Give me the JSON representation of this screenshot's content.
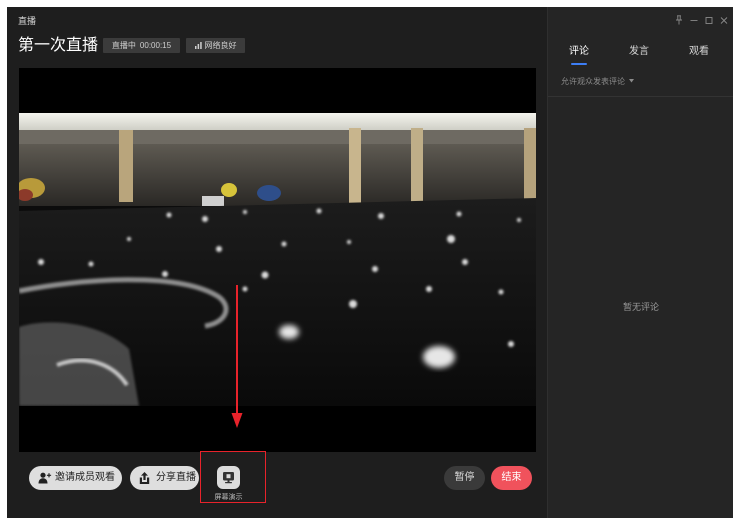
{
  "window": {
    "app_title": "直播"
  },
  "header": {
    "title": "第一次直播",
    "live_status": "直播中",
    "elapsed_time": "00:00:15",
    "network_status": "网络良好"
  },
  "side_panel": {
    "tabs": [
      {
        "label": "评论",
        "active": true
      },
      {
        "label": "发言",
        "active": false
      },
      {
        "label": "观看",
        "active": false
      }
    ],
    "comment_permission": "允许观众发表评论",
    "empty_message": "暂无评论"
  },
  "toolbar": {
    "invite_label": "邀请成员观看",
    "share_label": "分享直播",
    "screen_share_label": "屏幕演示",
    "pause_label": "暂停",
    "end_label": "结束"
  },
  "icons": {
    "pin": "pin-icon",
    "minimize": "minimize-icon",
    "maximize": "maximize-icon",
    "close": "close-icon",
    "network": "signal-icon",
    "invite": "add-person-icon",
    "share": "share-icon",
    "screen_share": "screen-share-icon",
    "permission_dropdown": "chevron-down-icon"
  },
  "colors": {
    "accent": "#3d7ef5",
    "end_button": "#f0525c",
    "annotation": "#e8232b",
    "background": "#1e1e1e",
    "side_panel": "#252525"
  }
}
